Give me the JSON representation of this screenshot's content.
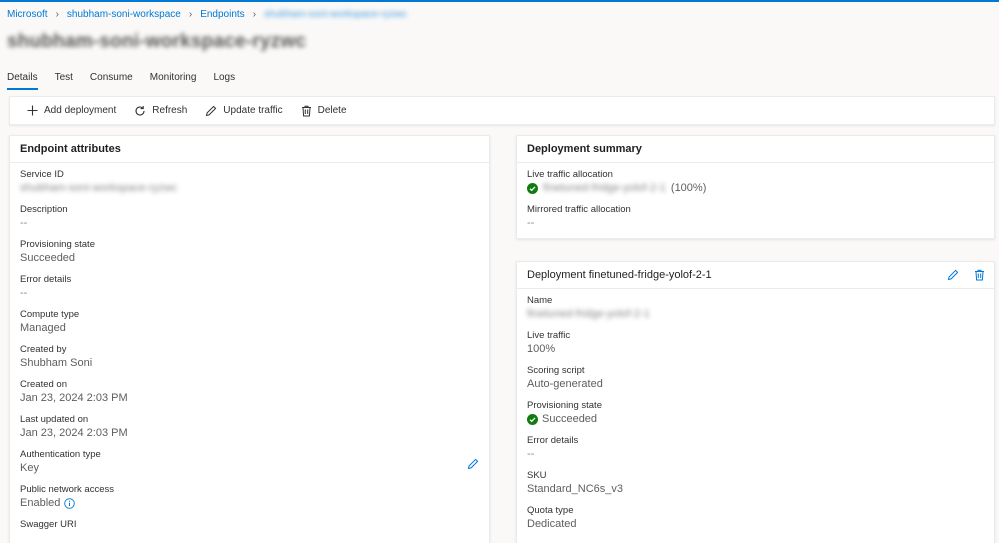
{
  "breadcrumb": [
    {
      "label": "Microsoft"
    },
    {
      "label": "shubham-soni-workspace"
    },
    {
      "label": "Endpoints"
    },
    {
      "label": "shubham-soni-workspace-ryzwc"
    }
  ],
  "page_title": "shubham-soni-workspace-ryzwc",
  "tabs": [
    "Details",
    "Test",
    "Consume",
    "Monitoring",
    "Logs"
  ],
  "toolbar": {
    "add": "Add deployment",
    "refresh": "Refresh",
    "update": "Update traffic",
    "delete": "Delete"
  },
  "attributes": {
    "title": "Endpoint attributes",
    "service_id_label": "Service ID",
    "service_id_value": "shubham-soni-workspace-ryzwc",
    "description_label": "Description",
    "description_value": "--",
    "prov_label": "Provisioning state",
    "prov_value": "Succeeded",
    "error_label": "Error details",
    "error_value": "--",
    "compute_label": "Compute type",
    "compute_value": "Managed",
    "created_by_label": "Created by",
    "created_by_value": "Shubham Soni",
    "created_on_label": "Created on",
    "created_on_value": "Jan 23, 2024 2:03 PM",
    "updated_label": "Last updated on",
    "updated_value": "Jan 23, 2024 2:03 PM",
    "auth_label": "Authentication type",
    "auth_value": "Key",
    "public_label": "Public network access",
    "public_value": "Enabled",
    "swagger_label": "Swagger URI"
  },
  "summary": {
    "title": "Deployment summary",
    "live_label": "Live traffic allocation",
    "live_name": "finetuned-fridge-yolof-2-1",
    "live_pct": "(100%)",
    "mirrored_label": "Mirrored traffic allocation",
    "mirrored_value": "--"
  },
  "deployment": {
    "title": "Deployment finetuned-fridge-yolof-2-1",
    "name_label": "Name",
    "name_value": "finetuned-fridge-yolof-2-1",
    "live_label": "Live traffic",
    "live_value": "100%",
    "scoring_label": "Scoring script",
    "scoring_value": "Auto-generated",
    "prov_label": "Provisioning state",
    "prov_value": "Succeeded",
    "error_label": "Error details",
    "error_value": "--",
    "sku_label": "SKU",
    "sku_value": "Standard_NC6s_v3",
    "quota_label": "Quota type",
    "quota_value": "Dedicated"
  },
  "colors": {
    "accent": "#0078d4",
    "success": "#107c10"
  }
}
